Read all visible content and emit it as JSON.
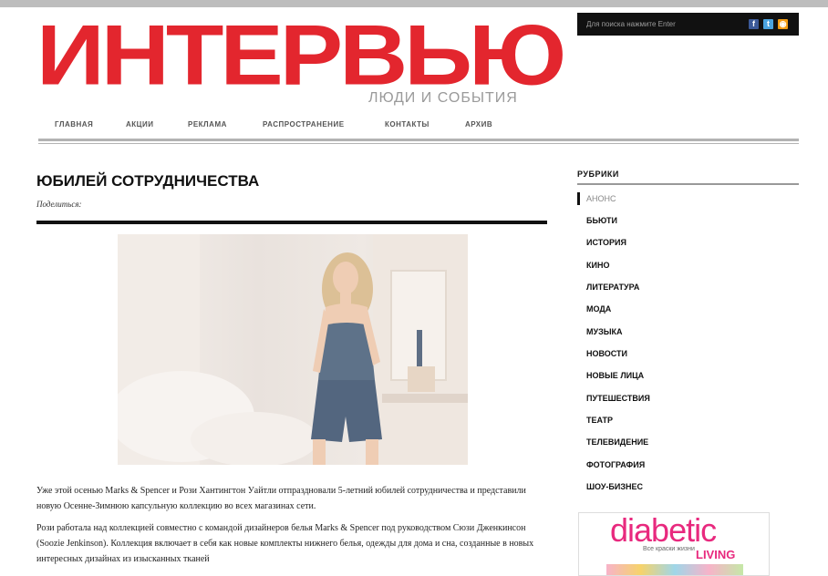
{
  "header": {
    "logo": "ИНТЕРВЬЮ",
    "tagline": "ЛЮДИ И СОБЫТИЯ",
    "search_hint": "Для поиска нажмите Enter"
  },
  "nav": {
    "items": [
      "ГЛАВНАЯ",
      "АКЦИИ",
      "РЕКЛАМА",
      "РАСПРОСТРАНЕНИЕ",
      "КОНТАКТЫ",
      "АРХИВ"
    ]
  },
  "article": {
    "title": "ЮБИЛЕЙ СОТРУДНИЧЕСТВА",
    "share_label": "Поделиться:",
    "paragraph1": "Уже этой осенью Marks & Spencer и Рози Хантингтон Уайтли отпраздновали 5-летний юбилей сотрудничества и представили новую Осенне-Зимнюю капсульную коллекцию во всех магазинах сети.",
    "paragraph2": "Рози работала над коллекцией совместно с командой дизайнеров белья Marks & Spencer под руководством Сюзи Дженкинсон (Soozie Jenkinson). Коллекция включает в себя как новые комплекты нижнего белья, одежды для дома и сна, созданные в новых интересных дизайнах из изысканных тканей"
  },
  "sidebar": {
    "title": "РУБРИКИ",
    "items": [
      "АНОНС",
      "БЬЮТИ",
      "ИСТОРИЯ",
      "КИНО",
      "ЛИТЕРАТУРА",
      "МОДА",
      "МУЗЫКА",
      "НОВОСТИ",
      "НОВЫЕ ЛИЦА",
      "ПУТЕШЕСТВИЯ",
      "ТЕАТР",
      "ТЕЛЕВИДЕНИЕ",
      "ФОТОГРАФИЯ",
      "ШОУ-БИЗНЕС"
    ],
    "active_item": "АНОНС"
  },
  "ad": {
    "brand": "diabetic",
    "subline": "Все краски жизни",
    "living": "LIVING"
  },
  "colors": {
    "brand_red": "#e3262e",
    "ad_pink": "#e8297e"
  },
  "icons": [
    "facebook-icon",
    "twitter-icon",
    "rss-icon"
  ]
}
